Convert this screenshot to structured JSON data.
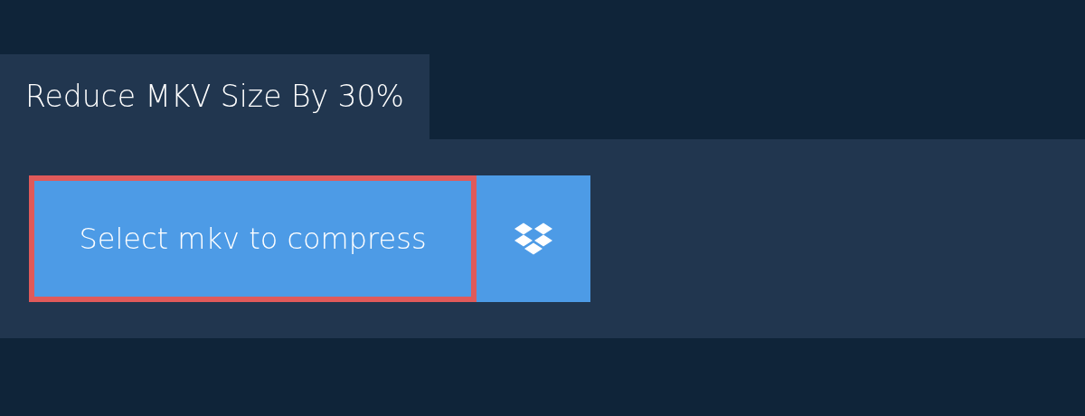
{
  "tab": {
    "label": "Reduce MKV Size By 30%"
  },
  "select_button": {
    "label": "Select mkv to compress",
    "focused": true
  }
}
